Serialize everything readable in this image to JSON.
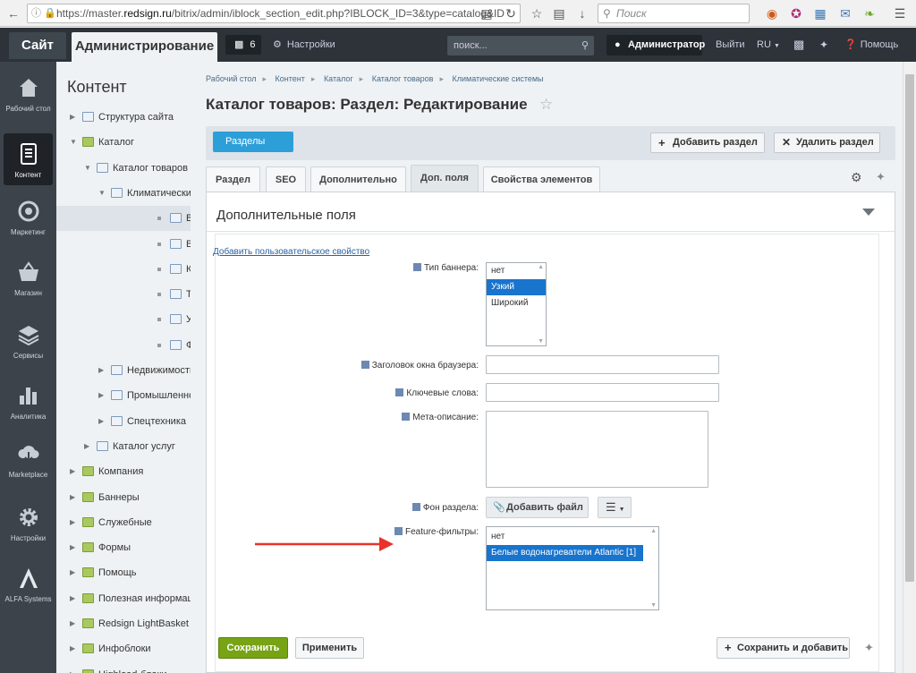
{
  "browser": {
    "url_prefix": "https://master.",
    "url_host": "redsign.ru",
    "url_path": "/bitrix/admin/iblock_section_edit.php?IBLOCK_ID=3&type=catalog&ID",
    "search_placeholder": "Поиск"
  },
  "topbar": {
    "site_label": "Сайт",
    "admin_label": "Администрирование",
    "notifications_count": "6",
    "settings_label": "Настройки",
    "search_placeholder": "поиск...",
    "user_label": "Администратор",
    "logout_label": "Выйти",
    "lang_label": "RU",
    "help_label": "Помощь"
  },
  "leftbar": {
    "items": [
      {
        "label": "Рабочий стол",
        "icon": "home-icon"
      },
      {
        "label": "Контент",
        "icon": "document-icon"
      },
      {
        "label": "Маркетинг",
        "icon": "target-icon"
      },
      {
        "label": "Магазин",
        "icon": "basket-icon"
      },
      {
        "label": "Сервисы",
        "icon": "layers-icon"
      },
      {
        "label": "Аналитика",
        "icon": "bar-chart-icon"
      },
      {
        "label": "Marketplace",
        "icon": "cloud-download-icon"
      },
      {
        "label": "Настройки",
        "icon": "gear-icon"
      },
      {
        "label": "ALFA Systems",
        "icon": "alfa-logo-icon"
      }
    ]
  },
  "tree": {
    "title": "Контент",
    "nodes": [
      {
        "label": "Структура сайта"
      },
      {
        "label": "Каталог"
      },
      {
        "label": "Каталог товаров"
      },
      {
        "label": "Климатические"
      },
      {
        "label": "Водонагрев"
      },
      {
        "label": "Воздухоочи"
      },
      {
        "label": "Кондиционе"
      },
      {
        "label": "Тепловое об"
      },
      {
        "label": "Увлажнител"
      },
      {
        "label": "Фильтры дл"
      },
      {
        "label": "Недвижимость"
      },
      {
        "label": "Промышленное"
      },
      {
        "label": "Спецтехника"
      },
      {
        "label": "Каталог услуг"
      },
      {
        "label": "Компания"
      },
      {
        "label": "Баннеры"
      },
      {
        "label": "Служебные"
      },
      {
        "label": "Формы"
      },
      {
        "label": "Помощь"
      },
      {
        "label": "Полезная информация"
      },
      {
        "label": "Redsign LightBasket"
      },
      {
        "label": "Инфоблоки"
      },
      {
        "label": "Highload-блоки"
      }
    ]
  },
  "breadcrumbs": [
    "Рабочий стол",
    "Контент",
    "Каталог",
    "Каталог товаров",
    "Климатические системы"
  ],
  "page_title": "Каталог товаров: Раздел: Редактирование",
  "actions": {
    "sections_label": "Разделы",
    "add_section_label": "Добавить раздел",
    "delete_section_label": "Удалить раздел"
  },
  "tabs": [
    "Раздел",
    "SEO",
    "Дополнительно",
    "Доп. поля",
    "Свойства элементов"
  ],
  "panel": {
    "title": "Дополнительные поля",
    "add_property_link": "Добавить пользовательское свойство",
    "banner_type_label": "Тип баннера:",
    "banner_type_options": [
      "нет",
      "Узкий",
      "Широкий"
    ],
    "banner_type_selected": "Узкий",
    "browser_title_label": "Заголовок окна браузера:",
    "keywords_label": "Ключевые слова:",
    "meta_description_label": "Мета-описание:",
    "background_label": "Фон раздела:",
    "add_file_label": "Добавить файл",
    "feature_filters_label": "Feature-фильтры:",
    "feature_filters_options": [
      "нет",
      "Белые водонагреватели Atlantic [1]"
    ],
    "feature_filters_selected": "Белые водонагреватели Atlantic [1]"
  },
  "footer": {
    "save_label": "Сохранить",
    "apply_label": "Применить",
    "save_add_label": "Сохранить и добавить"
  },
  "colors": {
    "annotation_arrow": "#e8322a",
    "save_button": "#77a315",
    "sections_button": "#2c9fd8",
    "selected_option": "#1874cd"
  }
}
